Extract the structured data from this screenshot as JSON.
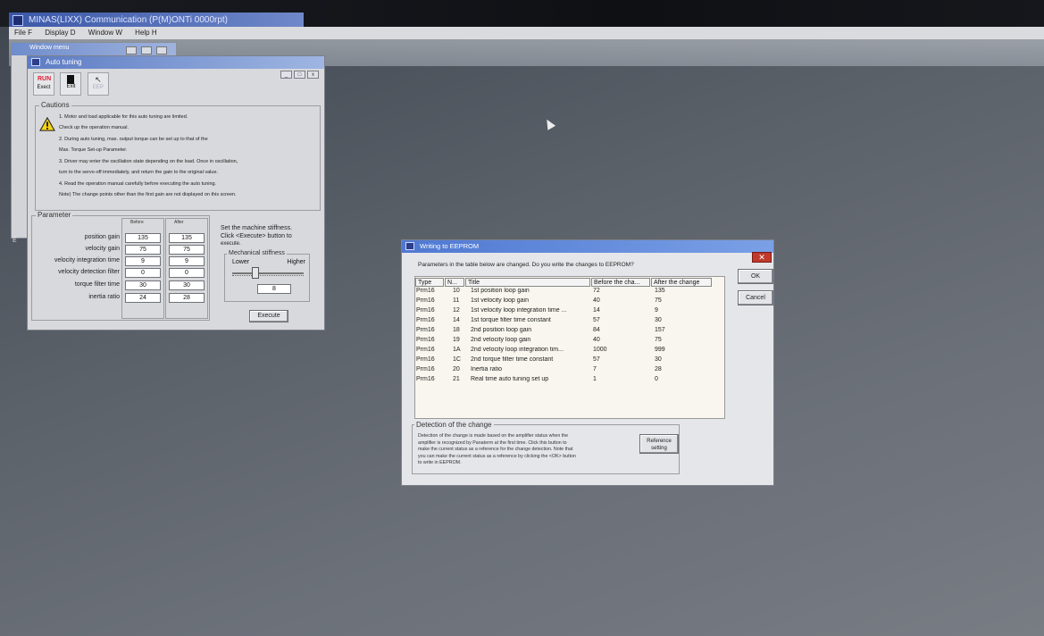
{
  "app": {
    "title": "MINAS(LIXX) Communication (P(M)ONTi 0000rpt)",
    "menu": [
      "File F",
      "Display D",
      "Window W",
      "Help H"
    ]
  },
  "window_menu": {
    "title": "Window menu"
  },
  "autotune": {
    "title": "Auto tuning",
    "toolbar": [
      {
        "top": "RUN",
        "label": "Exect"
      },
      {
        "top": "",
        "label": "Exit"
      },
      {
        "top": "",
        "label": "EEP"
      }
    ],
    "cautions_title": "Cautions",
    "cautions": [
      "1. Motor and load applicable for this auto tuning are limited.",
      "Check up the operation manual.",
      "2. During auto tuning, max. output torque can be set up to that of the",
      "Max. Torque Set-up Parameter.",
      "3. Driver may enter the oscillation state depending on the load. Once in oscillation,",
      "turn to the servo-off immediately, and return the gain to the original value.",
      "4. Read the operation manual carefully before executing the auto tuning.",
      "Note) The change points other than the first gain are not displayed on this screen."
    ],
    "parameter_title": "Parameter",
    "before_label": "Before",
    "after_label": "After",
    "params": [
      {
        "name": "position gain",
        "before": "135",
        "after": "135"
      },
      {
        "name": "velocity gain",
        "before": "75",
        "after": "75"
      },
      {
        "name": "velocity integration time",
        "before": "9",
        "after": "9"
      },
      {
        "name": "velocity detection filter",
        "before": "0",
        "after": "0"
      },
      {
        "name": "torque filter time",
        "before": "30",
        "after": "30"
      },
      {
        "name": "inertia ratio",
        "before": "24",
        "after": "28"
      }
    ],
    "stiffness_note": [
      "Set the machine stiffness.",
      "Click <Execute> button to",
      "execute."
    ],
    "mech_title": "Mechanical stiffness",
    "mech_lower": "Lower",
    "mech_higher": "Higher",
    "stiffness_value": "8",
    "execute_label": "Execute"
  },
  "eeprom": {
    "title": "Writing to EEPROM",
    "prompt": "Parameters in the table below are changed. Do you write the changes to EEPROM?",
    "ok_label": "OK",
    "cancel_label": "Cancel",
    "headers": [
      "Type",
      "N...",
      "Title",
      "Before the cha...",
      "After the change"
    ],
    "rows": [
      [
        "Prm16",
        "10",
        "1st position loop gain",
        "72",
        "135"
      ],
      [
        "Prm16",
        "11",
        "1st velocity loop gain",
        "40",
        "75"
      ],
      [
        "Prm16",
        "12",
        "1st velocity loop integration time ...",
        "14",
        "9"
      ],
      [
        "Prm16",
        "14",
        "1st torque filter time constant",
        "57",
        "30"
      ],
      [
        "Prm16",
        "18",
        "2nd position loop gain",
        "84",
        "157"
      ],
      [
        "Prm16",
        "19",
        "2nd velocity loop gain",
        "40",
        "75"
      ],
      [
        "Prm16",
        "1A",
        "2nd velocity loop integration tim...",
        "1000",
        "999"
      ],
      [
        "Prm16",
        "1C",
        "2nd torque filter time constant",
        "57",
        "30"
      ],
      [
        "Prm16",
        "20",
        "Inertia ratio",
        "7",
        "28"
      ],
      [
        "Prm16",
        "21",
        "Real time auto tuning set up",
        "1",
        "0"
      ]
    ],
    "detect_title": "Detection of the change",
    "detect_text": [
      "Detection of the change is made based on the amplifier status when the",
      "amplifier is recognized by Panaterm at the first time. Click this button to",
      "make the current status as a reference for the change detection. Note that",
      "you can make the current status as a reference by clicking the <OK> button",
      "to write in EEPROM."
    ],
    "reference_label": "Reference setting"
  }
}
